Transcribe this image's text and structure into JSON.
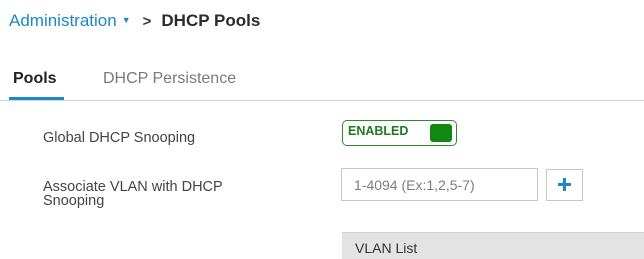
{
  "breadcrumb": {
    "parent": "Administration",
    "parent_caret": "▼",
    "separator": ">",
    "current": "DHCP Pools"
  },
  "tabs": [
    {
      "label": "Pools",
      "active": true
    },
    {
      "label": "DHCP Persistence",
      "active": false
    }
  ],
  "form": {
    "global_snooping_label": "Global DHCP Snooping",
    "global_snooping_state": "ENABLED",
    "associate_vlan_label": "Associate VLAN with DHCP Snooping",
    "vlan_input_placeholder": "1-4094 (Ex:1,2,5-7)",
    "vlan_input_value": "",
    "add_button_icon": "plus-icon"
  },
  "vlan_list": {
    "header": "VLAN List"
  },
  "colors": {
    "accent": "#1d86c6",
    "enabled_green": "#128812"
  }
}
